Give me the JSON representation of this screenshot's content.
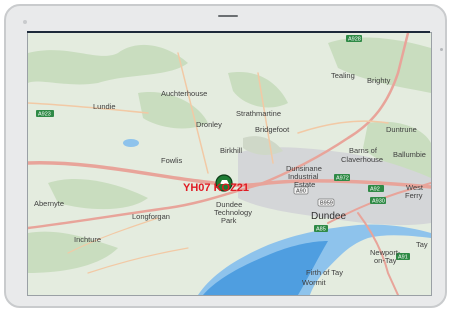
{
  "device": {
    "type": "tablet"
  },
  "map": {
    "places": {
      "auchterhouse": "Auchterhouse",
      "lundie": "Lundie",
      "strathmartine": "Strathmartine",
      "dronley": "Dronley",
      "bridgefoot": "Bridgefoot",
      "tealing": "Tealing",
      "brighty": "Brighty",
      "duntrune": "Duntrune",
      "birkhill": "Birkhill",
      "fowlis": "Fowlis",
      "barns_of": "Barns of",
      "claverhouse": "Claverhouse",
      "ballumbie": "Ballumbie",
      "dunsinane": "Dunsinane",
      "industrial": "Industrial",
      "estate": "Estate",
      "abernyte": "Abernyte",
      "dundee_tech1": "Dundee",
      "dundee_tech2": "Technology",
      "dundee_tech3": "Park",
      "longforgan": "Longforgan",
      "dundee": "Dundee",
      "west": "West",
      "ferry": "Ferry",
      "inchture": "Inchture",
      "newport1": "Newport-",
      "newport2": "on-Tay",
      "tay": "Tay",
      "firth1": "Firth of Tay",
      "wormit": "Wormit"
    },
    "roads": {
      "a928": "A928",
      "a923": "A923",
      "a90": "A90",
      "a972": "A972",
      "a92": "A92",
      "b959": "B959",
      "a930": "A930",
      "a85": "A85",
      "a91": "A91"
    },
    "vehicle_marker": {
      "label": "YH07 KOZ21",
      "icon": "vehicle-pin-icon",
      "color": "#1e7d34"
    }
  }
}
